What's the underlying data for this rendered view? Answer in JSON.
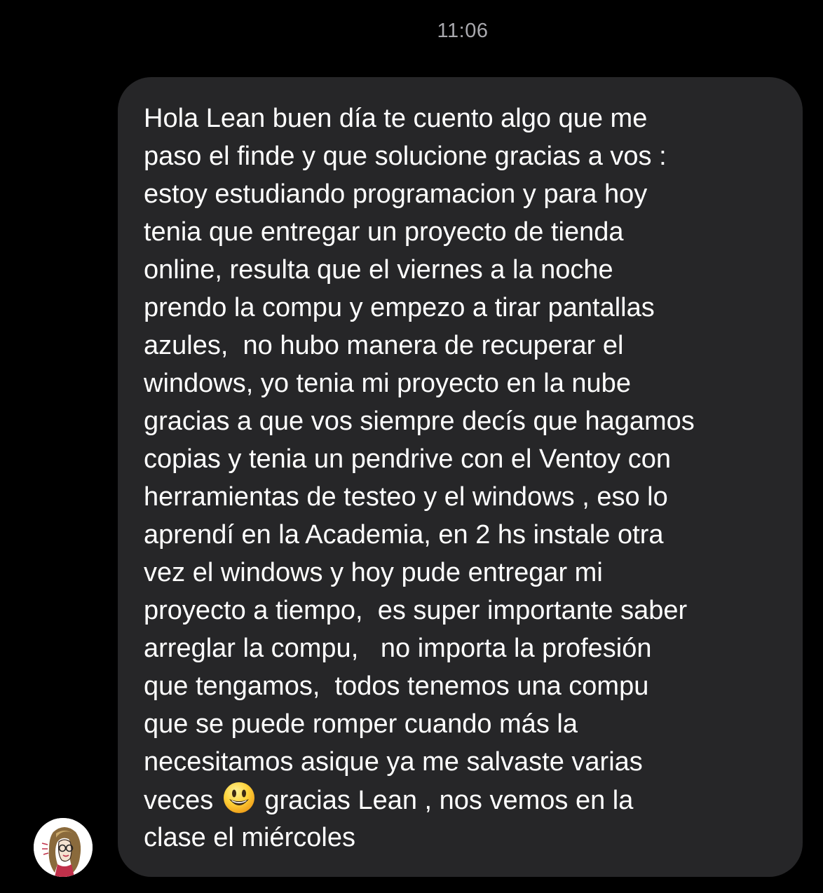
{
  "timestamp": "11:06",
  "message": {
    "lines": [
      "Hola Lean buen día te cuento algo que me",
      "paso el finde y que solucione gracias a vos :",
      "estoy estudiando programacion y para hoy",
      "tenia que entregar un proyecto de tienda",
      "online, resulta que el viernes a la noche",
      "prendo la compu y empezo a tirar pantallas",
      "azules,  no hubo manera de recuperar el",
      "windows, yo tenia mi proyecto en la nube",
      "gracias a que vos siempre decís que hagamos",
      "copias y tenia un pendrive con el Ventoy con",
      "herramientas de testeo y el windows , eso lo",
      "aprendí en la Academia, en 2 hs instale otra",
      "vez el windows y hoy pude entregar mi",
      "proyecto a tiempo,  es super importante saber",
      "arreglar la compu,   no importa la profesión",
      "que tengamos,  todos tenemos una compu",
      "que se puede romper cuando más la",
      "necesitamos asique ya me salvaste varias"
    ],
    "line_with_emoji_before": "veces ",
    "emoji_icon": "smiley-emoji-icon",
    "line_with_emoji_after": " gracias Lean , nos vemos en la",
    "last_line": "clase el miércoles"
  },
  "avatar": {
    "icon": "sender-avatar"
  },
  "colors": {
    "background": "#000000",
    "bubble": "#262628",
    "text": "#ffffff",
    "timestamp": "#a8a8ad"
  }
}
